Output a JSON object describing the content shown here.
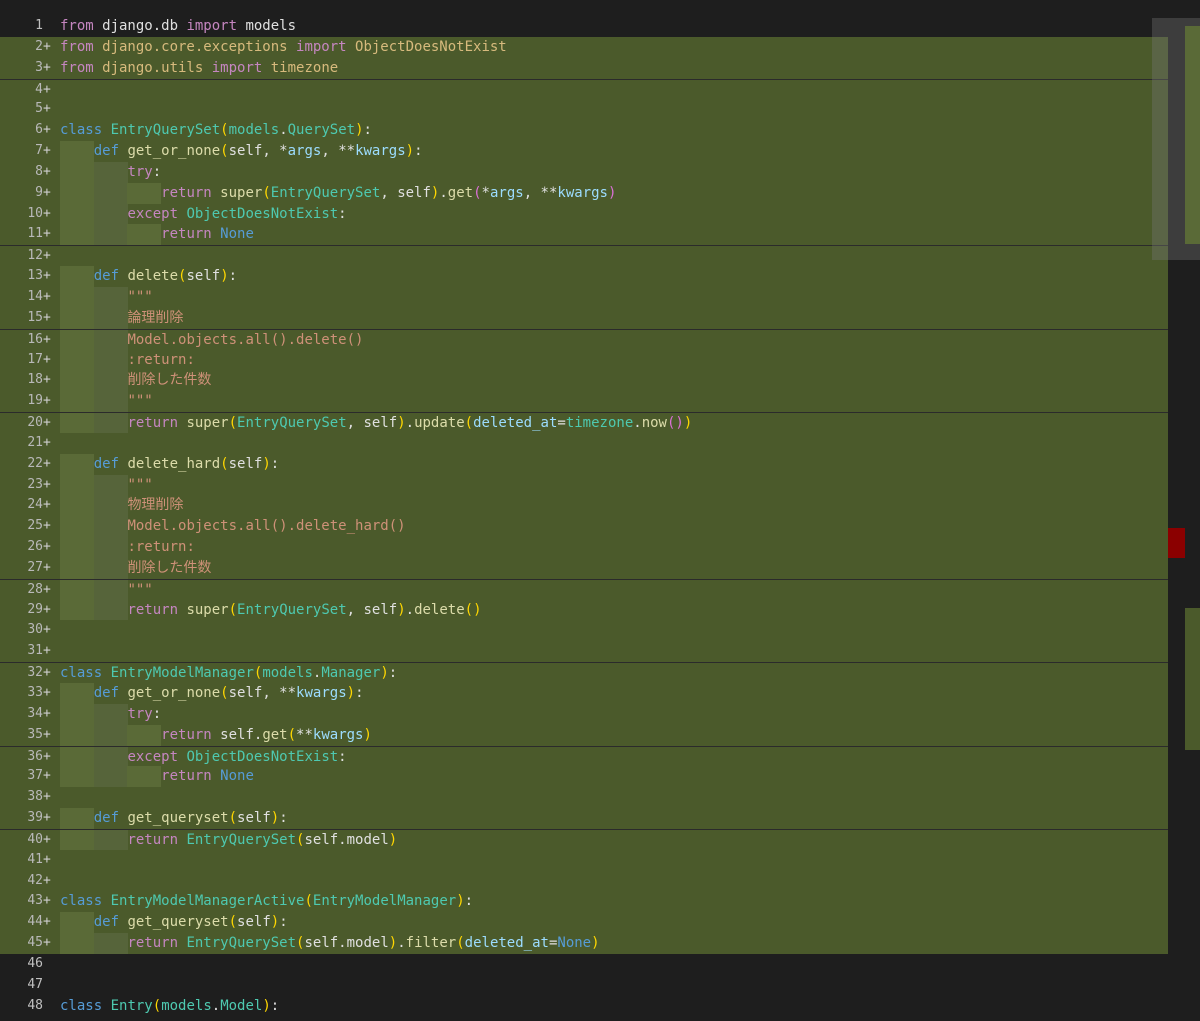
{
  "editor": {
    "lines": [
      {
        "n": "1",
        "added": false,
        "indent": 0,
        "tokens": [
          [
            "kw",
            "from"
          ],
          [
            "plain",
            " django.db "
          ],
          [
            "kw",
            "import"
          ],
          [
            "plain",
            " models"
          ]
        ]
      },
      {
        "n": "2",
        "added": true,
        "indent": 0,
        "tokens": [
          [
            "kw",
            "from"
          ],
          [
            "str",
            " django.core.exceptions "
          ],
          [
            "kw",
            "import"
          ],
          [
            "str",
            " ObjectDoesNotExist"
          ]
        ]
      },
      {
        "n": "3",
        "added": true,
        "indent": 0,
        "tokens": [
          [
            "kw",
            "from"
          ],
          [
            "str",
            " django.utils "
          ],
          [
            "kw",
            "import"
          ],
          [
            "str",
            " timezone"
          ]
        ]
      },
      {
        "n": "4",
        "added": true,
        "indent": 0,
        "tokens": []
      },
      {
        "n": "5",
        "added": true,
        "indent": 0,
        "tokens": []
      },
      {
        "n": "6",
        "added": true,
        "indent": 0,
        "tokens": [
          [
            "kw2",
            "class"
          ],
          [
            "plain",
            " "
          ],
          [
            "cls",
            "EntryQuerySet"
          ],
          [
            "par",
            "("
          ],
          [
            "mod",
            "models"
          ],
          [
            "plain",
            "."
          ],
          [
            "cls",
            "QuerySet"
          ],
          [
            "par",
            ")"
          ],
          [
            "plain",
            ":"
          ]
        ]
      },
      {
        "n": "7",
        "added": true,
        "indent": 1,
        "tokens": [
          [
            "kw2",
            "def"
          ],
          [
            "plain",
            " "
          ],
          [
            "fn",
            "get_or_none"
          ],
          [
            "par",
            "("
          ],
          [
            "plain",
            "self, *"
          ],
          [
            "var",
            "args"
          ],
          [
            "plain",
            ", **"
          ],
          [
            "var",
            "kwargs"
          ],
          [
            "par",
            ")"
          ],
          [
            "plain",
            ":"
          ]
        ]
      },
      {
        "n": "8",
        "added": true,
        "indent": 2,
        "tokens": [
          [
            "kw",
            "try"
          ],
          [
            "plain",
            ":"
          ]
        ]
      },
      {
        "n": "9",
        "added": true,
        "indent": 3,
        "tokens": [
          [
            "kw",
            "return"
          ],
          [
            "plain",
            " "
          ],
          [
            "fn",
            "super"
          ],
          [
            "par",
            "("
          ],
          [
            "cls",
            "EntryQuerySet"
          ],
          [
            "plain",
            ", self"
          ],
          [
            "par",
            ")"
          ],
          [
            "plain",
            "."
          ],
          [
            "fn",
            "get"
          ],
          [
            "par2",
            "("
          ],
          [
            "plain",
            "*"
          ],
          [
            "var",
            "args"
          ],
          [
            "plain",
            ", **"
          ],
          [
            "var",
            "kwargs"
          ],
          [
            "par2",
            ")"
          ]
        ]
      },
      {
        "n": "10",
        "added": true,
        "indent": 2,
        "tokens": [
          [
            "kw",
            "except"
          ],
          [
            "plain",
            " "
          ],
          [
            "cls",
            "ObjectDoesNotExist"
          ],
          [
            "plain",
            ":"
          ]
        ]
      },
      {
        "n": "11",
        "added": true,
        "indent": 3,
        "tokens": [
          [
            "kw",
            "return"
          ],
          [
            "plain",
            " "
          ],
          [
            "const",
            "None"
          ]
        ]
      },
      {
        "n": "12",
        "added": true,
        "indent": 0,
        "tokens": []
      },
      {
        "n": "13",
        "added": true,
        "indent": 1,
        "tokens": [
          [
            "kw2",
            "def"
          ],
          [
            "plain",
            " "
          ],
          [
            "fn",
            "delete"
          ],
          [
            "par",
            "("
          ],
          [
            "plain",
            "self"
          ],
          [
            "par",
            ")"
          ],
          [
            "plain",
            ":"
          ]
        ]
      },
      {
        "n": "14",
        "added": true,
        "indent": 2,
        "tokens": [
          [
            "doc",
            "\"\"\""
          ]
        ]
      },
      {
        "n": "15",
        "added": true,
        "indent": 2,
        "tokens": [
          [
            "doc",
            "論理削除"
          ]
        ]
      },
      {
        "n": "16",
        "added": true,
        "indent": 2,
        "tokens": [
          [
            "doc",
            "Model.objects.all().delete()"
          ]
        ]
      },
      {
        "n": "17",
        "added": true,
        "indent": 2,
        "tokens": [
          [
            "doc",
            ":return:"
          ]
        ]
      },
      {
        "n": "18",
        "added": true,
        "indent": 2,
        "tokens": [
          [
            "doc",
            "削除した件数"
          ]
        ]
      },
      {
        "n": "19",
        "added": true,
        "indent": 2,
        "tokens": [
          [
            "doc",
            "\"\"\""
          ]
        ]
      },
      {
        "n": "20",
        "added": true,
        "indent": 2,
        "tokens": [
          [
            "kw",
            "return"
          ],
          [
            "plain",
            " "
          ],
          [
            "fn",
            "super"
          ],
          [
            "par",
            "("
          ],
          [
            "cls",
            "EntryQuerySet"
          ],
          [
            "plain",
            ", self"
          ],
          [
            "par",
            ")"
          ],
          [
            "plain",
            "."
          ],
          [
            "fn",
            "update"
          ],
          [
            "par",
            "("
          ],
          [
            "var",
            "deleted_at"
          ],
          [
            "plain",
            "="
          ],
          [
            "mod",
            "timezone"
          ],
          [
            "plain",
            "."
          ],
          [
            "fn",
            "now"
          ],
          [
            "par2",
            "()"
          ],
          [
            "par",
            ")"
          ]
        ]
      },
      {
        "n": "21",
        "added": true,
        "indent": 0,
        "tokens": []
      },
      {
        "n": "22",
        "added": true,
        "indent": 1,
        "tokens": [
          [
            "kw2",
            "def"
          ],
          [
            "plain",
            " "
          ],
          [
            "fn",
            "delete_hard"
          ],
          [
            "par",
            "("
          ],
          [
            "plain",
            "self"
          ],
          [
            "par",
            ")"
          ],
          [
            "plain",
            ":"
          ]
        ]
      },
      {
        "n": "23",
        "added": true,
        "indent": 2,
        "tokens": [
          [
            "doc",
            "\"\"\""
          ]
        ]
      },
      {
        "n": "24",
        "added": true,
        "indent": 2,
        "tokens": [
          [
            "doc",
            "物理削除"
          ]
        ]
      },
      {
        "n": "25",
        "added": true,
        "indent": 2,
        "tokens": [
          [
            "doc",
            "Model.objects.all().delete_hard()"
          ]
        ]
      },
      {
        "n": "26",
        "added": true,
        "indent": 2,
        "tokens": [
          [
            "doc",
            ":return:"
          ]
        ]
      },
      {
        "n": "27",
        "added": true,
        "indent": 2,
        "tokens": [
          [
            "doc",
            "削除した件数"
          ]
        ]
      },
      {
        "n": "28",
        "added": true,
        "indent": 2,
        "tokens": [
          [
            "doc",
            "\"\"\""
          ]
        ]
      },
      {
        "n": "29",
        "added": true,
        "indent": 2,
        "tokens": [
          [
            "kw",
            "return"
          ],
          [
            "plain",
            " "
          ],
          [
            "fn",
            "super"
          ],
          [
            "par",
            "("
          ],
          [
            "cls",
            "EntryQuerySet"
          ],
          [
            "plain",
            ", self"
          ],
          [
            "par",
            ")"
          ],
          [
            "plain",
            "."
          ],
          [
            "fn",
            "delete"
          ],
          [
            "par",
            "()"
          ]
        ]
      },
      {
        "n": "30",
        "added": true,
        "indent": 0,
        "tokens": []
      },
      {
        "n": "31",
        "added": true,
        "indent": 0,
        "tokens": []
      },
      {
        "n": "32",
        "added": true,
        "indent": 0,
        "tokens": [
          [
            "kw2",
            "class"
          ],
          [
            "plain",
            " "
          ],
          [
            "cls",
            "EntryModelManager"
          ],
          [
            "par",
            "("
          ],
          [
            "mod",
            "models"
          ],
          [
            "plain",
            "."
          ],
          [
            "cls",
            "Manager"
          ],
          [
            "par",
            ")"
          ],
          [
            "plain",
            ":"
          ]
        ]
      },
      {
        "n": "33",
        "added": true,
        "indent": 1,
        "tokens": [
          [
            "kw2",
            "def"
          ],
          [
            "plain",
            " "
          ],
          [
            "fn",
            "get_or_none"
          ],
          [
            "par",
            "("
          ],
          [
            "plain",
            "self, **"
          ],
          [
            "var",
            "kwargs"
          ],
          [
            "par",
            ")"
          ],
          [
            "plain",
            ":"
          ]
        ]
      },
      {
        "n": "34",
        "added": true,
        "indent": 2,
        "tokens": [
          [
            "kw",
            "try"
          ],
          [
            "plain",
            ":"
          ]
        ]
      },
      {
        "n": "35",
        "added": true,
        "indent": 3,
        "tokens": [
          [
            "kw",
            "return"
          ],
          [
            "plain",
            " self."
          ],
          [
            "fn",
            "get"
          ],
          [
            "par",
            "("
          ],
          [
            "plain",
            "**"
          ],
          [
            "var",
            "kwargs"
          ],
          [
            "par",
            ")"
          ]
        ]
      },
      {
        "n": "36",
        "added": true,
        "indent": 2,
        "tokens": [
          [
            "kw",
            "except"
          ],
          [
            "plain",
            " "
          ],
          [
            "cls",
            "ObjectDoesNotExist"
          ],
          [
            "plain",
            ":"
          ]
        ]
      },
      {
        "n": "37",
        "added": true,
        "indent": 3,
        "tokens": [
          [
            "kw",
            "return"
          ],
          [
            "plain",
            " "
          ],
          [
            "const",
            "None"
          ]
        ]
      },
      {
        "n": "38",
        "added": true,
        "indent": 0,
        "tokens": []
      },
      {
        "n": "39",
        "added": true,
        "indent": 1,
        "tokens": [
          [
            "kw2",
            "def"
          ],
          [
            "plain",
            " "
          ],
          [
            "fn",
            "get_queryset"
          ],
          [
            "par",
            "("
          ],
          [
            "plain",
            "self"
          ],
          [
            "par",
            ")"
          ],
          [
            "plain",
            ":"
          ]
        ]
      },
      {
        "n": "40",
        "added": true,
        "indent": 2,
        "tokens": [
          [
            "kw",
            "return"
          ],
          [
            "plain",
            " "
          ],
          [
            "cls",
            "EntryQuerySet"
          ],
          [
            "par",
            "("
          ],
          [
            "plain",
            "self.model"
          ],
          [
            "par",
            ")"
          ]
        ]
      },
      {
        "n": "41",
        "added": true,
        "indent": 0,
        "tokens": []
      },
      {
        "n": "42",
        "added": true,
        "indent": 0,
        "tokens": []
      },
      {
        "n": "43",
        "added": true,
        "indent": 0,
        "tokens": [
          [
            "kw2",
            "class"
          ],
          [
            "plain",
            " "
          ],
          [
            "cls",
            "EntryModelManagerActive"
          ],
          [
            "par",
            "("
          ],
          [
            "cls",
            "EntryModelManager"
          ],
          [
            "par",
            ")"
          ],
          [
            "plain",
            ":"
          ]
        ]
      },
      {
        "n": "44",
        "added": true,
        "indent": 1,
        "tokens": [
          [
            "kw2",
            "def"
          ],
          [
            "plain",
            " "
          ],
          [
            "fn",
            "get_queryset"
          ],
          [
            "par",
            "("
          ],
          [
            "plain",
            "self"
          ],
          [
            "par",
            ")"
          ],
          [
            "plain",
            ":"
          ]
        ]
      },
      {
        "n": "45",
        "added": true,
        "indent": 2,
        "tokens": [
          [
            "kw",
            "return"
          ],
          [
            "plain",
            " "
          ],
          [
            "cls",
            "EntryQuerySet"
          ],
          [
            "par",
            "("
          ],
          [
            "plain",
            "self.model"
          ],
          [
            "par",
            ")"
          ],
          [
            "plain",
            "."
          ],
          [
            "fn",
            "filter"
          ],
          [
            "par",
            "("
          ],
          [
            "var",
            "deleted_at"
          ],
          [
            "plain",
            "="
          ],
          [
            "const",
            "None"
          ],
          [
            "par",
            ")"
          ]
        ]
      },
      {
        "n": "46",
        "added": false,
        "indent": 0,
        "tokens": []
      },
      {
        "n": "47",
        "added": false,
        "indent": 0,
        "tokens": []
      },
      {
        "n": "48",
        "added": false,
        "indent": 0,
        "tokens": [
          [
            "kw2",
            "class"
          ],
          [
            "plain",
            " "
          ],
          [
            "cls",
            "Entry"
          ],
          [
            "par",
            "("
          ],
          [
            "mod",
            "models"
          ],
          [
            "plain",
            "."
          ],
          [
            "cls",
            "Model"
          ],
          [
            "par",
            ")"
          ],
          [
            "plain",
            ":"
          ]
        ]
      }
    ],
    "added_marker": "+",
    "colors": {
      "background": "#1e1e1e",
      "added_line": "#4b5a2b",
      "indent_guide": "#5a6a37",
      "minimap_marker_red": "#8b0000"
    }
  }
}
